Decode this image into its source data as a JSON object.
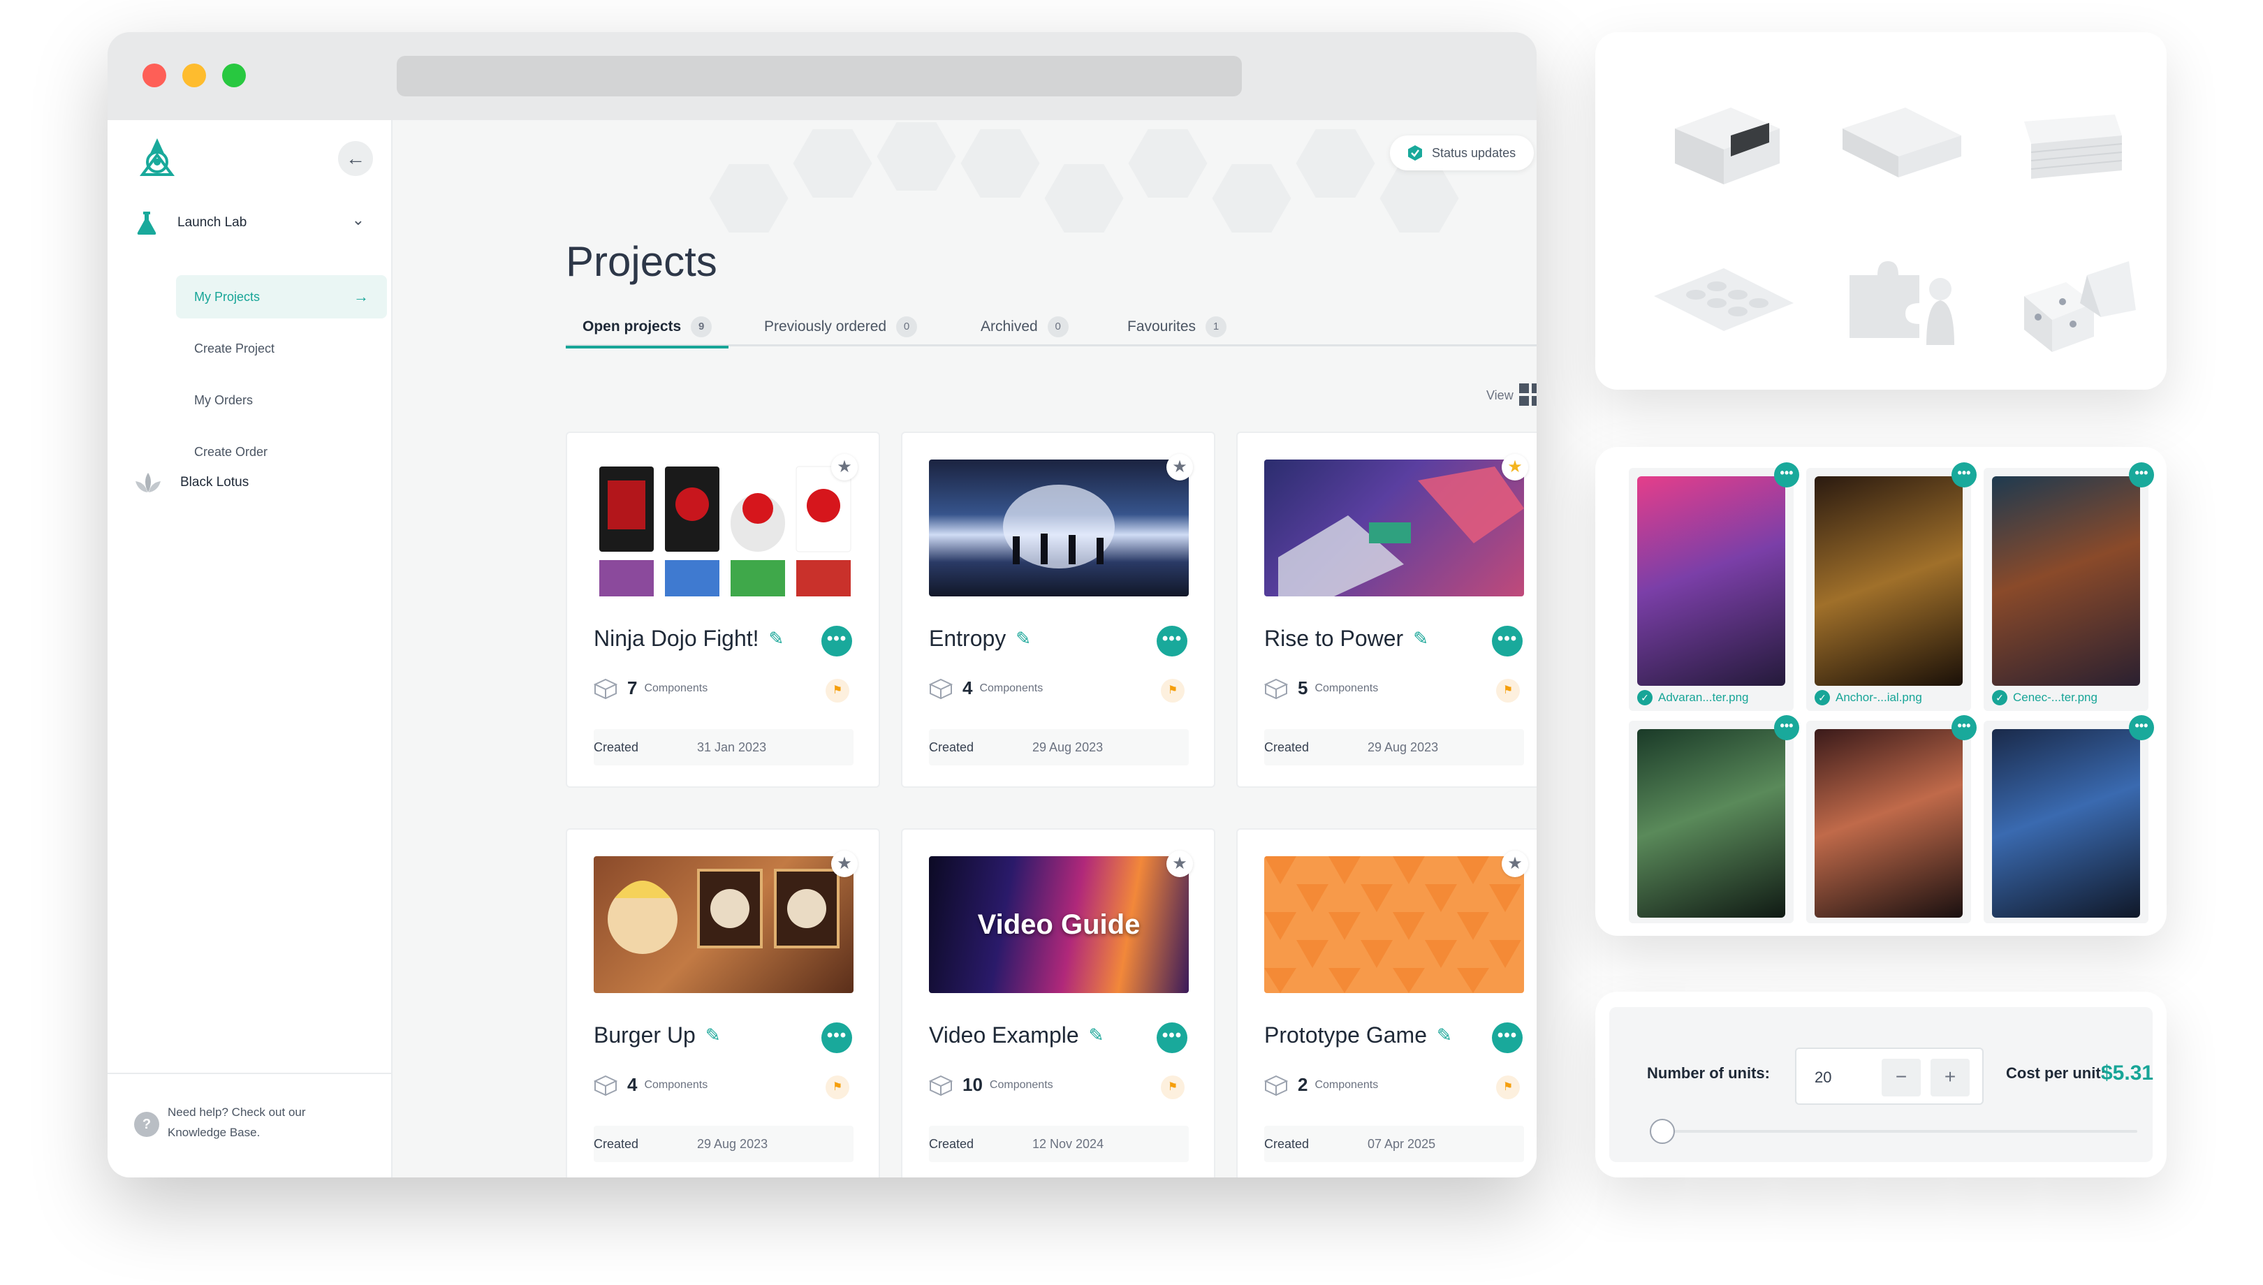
{
  "sidebar": {
    "groups": [
      {
        "label": "Launch Lab"
      },
      {
        "label": "Black Lotus"
      }
    ],
    "items": [
      {
        "label": "My Projects"
      },
      {
        "label": "Create Project"
      },
      {
        "label": "My Orders"
      },
      {
        "label": "Create Order"
      }
    ],
    "help_text": "Need help? Check out our Knowledge Base."
  },
  "header": {
    "status_label": "Status updates"
  },
  "main": {
    "title": "Projects",
    "tabs": [
      {
        "label": "Open projects",
        "count": "9"
      },
      {
        "label": "Previously ordered",
        "count": "0"
      },
      {
        "label": "Archived",
        "count": "0"
      },
      {
        "label": "Favourites",
        "count": "1"
      }
    ],
    "view_label": "View",
    "components_label": "Components",
    "created_label": "Created",
    "projects": [
      {
        "name": "Ninja Dojo Fight!",
        "components": "7",
        "created": "31 Jan 2023"
      },
      {
        "name": "Entropy",
        "components": "4",
        "created": "29 Aug 2023"
      },
      {
        "name": "Rise to Power",
        "components": "5",
        "created": "29 Aug 2023"
      },
      {
        "name": "Burger Up",
        "components": "4",
        "created": "29 Aug 2023"
      },
      {
        "name": "Video Example",
        "components": "10",
        "created": "12 Nov 2024"
      },
      {
        "name": "Prototype Game",
        "components": "2",
        "created": "07 Apr 2025"
      }
    ],
    "video_thumb_text": "Video Guide"
  },
  "card_files": [
    {
      "file": "Advaran...ter.png"
    },
    {
      "file": "Anchor-...ial.png"
    },
    {
      "file": "Cenec-...ter.png"
    }
  ],
  "pricing": {
    "units_label": "Number of units:",
    "units_value": "20",
    "cost_label": "Cost per unit:",
    "cost_value": "$5.31"
  },
  "colors": {
    "accent": "#17a597",
    "favourite": "#f4b51f",
    "flag": "#f59e0b"
  }
}
